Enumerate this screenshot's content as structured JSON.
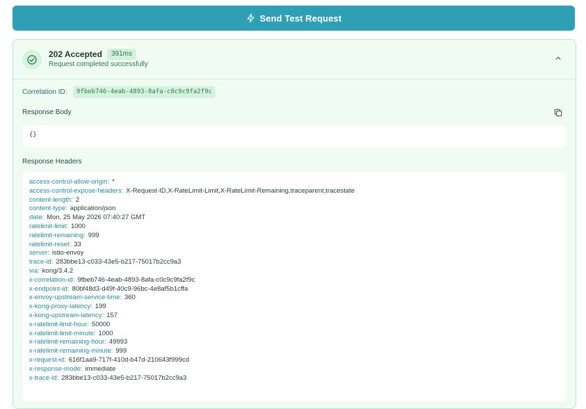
{
  "toolbar": {
    "send_label": "Send Test Request",
    "send_icon": "lightning-icon"
  },
  "response": {
    "status": "202 Accepted",
    "latency": "391ms",
    "message": "Request completed successfully",
    "correlation_label": "Correlation ID:",
    "correlation_id": "9fbeb746-4eab-4893-8afa-c8c9c9fa2f9c",
    "body_label": "Response Body",
    "body": "{}",
    "headers_label": "Response Headers",
    "headers": [
      {
        "key": "access-control-allow-origin:",
        "value": "*"
      },
      {
        "key": "access-control-expose-headers:",
        "value": "X-Request-ID,X-RateLimit-Limit,X-RateLimit-Remaining,traceparent,tracestate"
      },
      {
        "key": "content-length:",
        "value": "2"
      },
      {
        "key": "content-type:",
        "value": "application/json"
      },
      {
        "key": "date:",
        "value": "Mon, 25 May 2026 07:40:27 GMT"
      },
      {
        "key": "ratelimit-limit:",
        "value": "1000"
      },
      {
        "key": "ratelimit-remaining:",
        "value": "999"
      },
      {
        "key": "ratelimit-reset:",
        "value": "33"
      },
      {
        "key": "server:",
        "value": "istio-envoy"
      },
      {
        "key": "trace-id:",
        "value": "283bbe13-c033-43e5-b217-75017b2cc9a3"
      },
      {
        "key": "via:",
        "value": "kong/3.4.2"
      },
      {
        "key": "x-correlation-id:",
        "value": "9fbeb746-4eab-4893-8afa-c0c9c9fa2f9c"
      },
      {
        "key": "x-endpoint-id:",
        "value": "80bf48d3-d49f-40c9-96bc-4e8af5b1cffa"
      },
      {
        "key": "x-envoy-upstream-service-time:",
        "value": "360"
      },
      {
        "key": "x-kong-proxy-latency:",
        "value": "199"
      },
      {
        "key": "x-kong-upstream-latency:",
        "value": "157"
      },
      {
        "key": "x-ratelimit-limit-hour:",
        "value": "50000"
      },
      {
        "key": "x-ratelimit-limit-minute:",
        "value": "1000"
      },
      {
        "key": "x-ratelimit-remaining-hour:",
        "value": "49993"
      },
      {
        "key": "x-ratelimit-remaining-minute:",
        "value": "999"
      },
      {
        "key": "x-request-id:",
        "value": "616f1aa9-717f-410d-b47d-210643f999cd"
      },
      {
        "key": "x-response-mode:",
        "value": "immediate"
      },
      {
        "key": "x-trace-id:",
        "value": "283bbe13-c033-43e5-b217-75017b2cc9a3"
      }
    ]
  },
  "colors": {
    "accent": "#2f9fb6",
    "success_bg": "#f0fbf3",
    "success_text": "#2f7b4b",
    "header_key": "#2a8aa4"
  }
}
